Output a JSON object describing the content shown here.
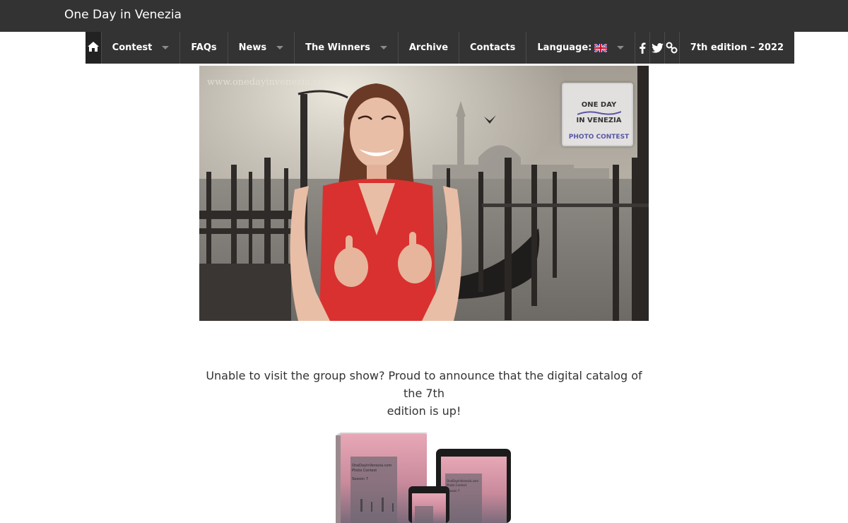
{
  "site": {
    "title": "One Day in Venezia"
  },
  "nav": {
    "items": [
      {
        "id": "contest",
        "label": "Contest",
        "dropdown": true
      },
      {
        "id": "faqs",
        "label": "FAQs",
        "dropdown": false
      },
      {
        "id": "news",
        "label": "News",
        "dropdown": true
      },
      {
        "id": "winners",
        "label": "The Winners",
        "dropdown": true
      },
      {
        "id": "archive",
        "label": "Archive",
        "dropdown": false
      },
      {
        "id": "contacts",
        "label": "Contacts",
        "dropdown": false
      }
    ],
    "language_label": "Language:",
    "edition_label": "7th edition – 2022",
    "icons": [
      "home-icon",
      "chevron-down-icon",
      "uk-flag-icon",
      "facebook-icon",
      "twitter-icon",
      "link-icon"
    ]
  },
  "video": {
    "watermark_url": "www.onedayinvenezia.com",
    "logo": {
      "line1": "ONE DAY",
      "line2": "IN VENEZIA",
      "line3": "PHOTO CONTEST"
    }
  },
  "content": {
    "announcement_line1": "Unable to visit the group show? Proud to announce that the digital catalog of the 7th",
    "announcement_line2": "edition is up!"
  },
  "catalog": {
    "book_line1": "OneDayInVenezia.com",
    "book_line2": "Photo Contest",
    "book_line3": "Season 7",
    "tablet_line1": "OneDayInVenezia.com",
    "tablet_line2": "Photo Contest",
    "tablet_line3": "Season 7"
  },
  "colors": {
    "bar": "#333333",
    "home_bg": "#222222",
    "text": "#333333",
    "logo_accent": "#5a55a8"
  }
}
